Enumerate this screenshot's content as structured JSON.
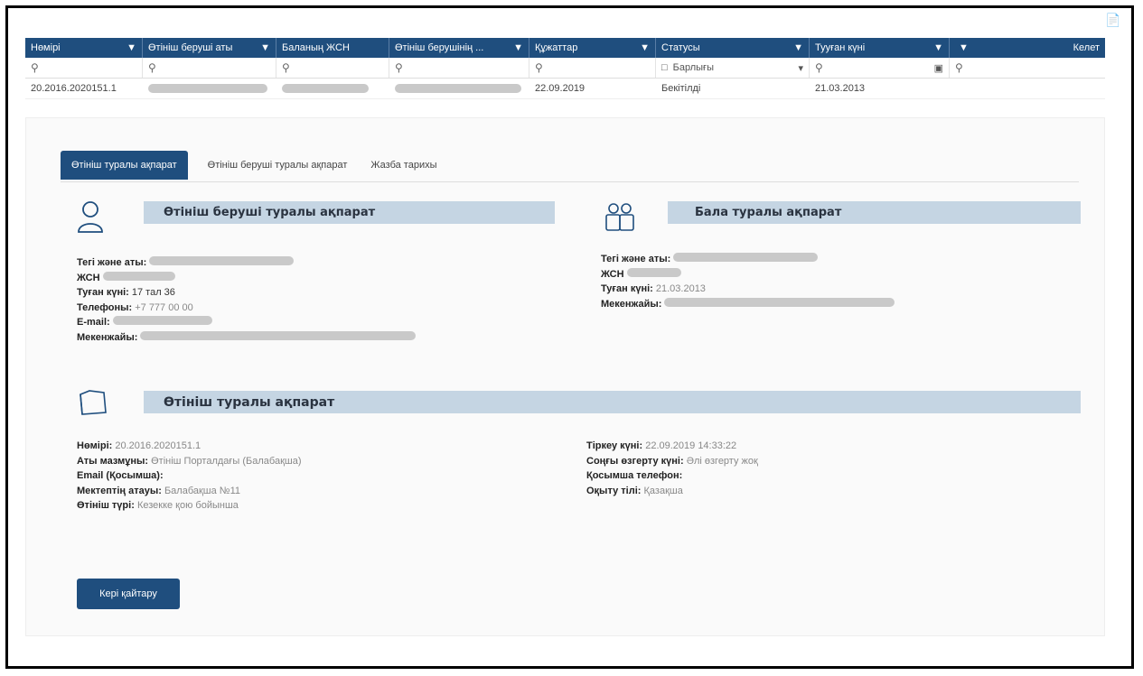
{
  "grid": {
    "headers": [
      "Нөмірі",
      "Өтініш беруші аты",
      "Баланың ЖСН",
      "Өтініш берушінің ...",
      "Құжаттар",
      "Статусы",
      "Тууған күні",
      "",
      "Келет"
    ],
    "filter_status": "Барлығы",
    "row": {
      "number": "20.2016.2020151.1",
      "date": "22.09.2019",
      "status": "Бекітілді",
      "birth_date": "21.03.2013"
    }
  },
  "tabs": [
    "Өтініш туралы ақпарат",
    "Өтініш беруші туралы ақпарат",
    "Жазба тарихы"
  ],
  "applicant": {
    "title": "Өтініш беруші туралы ақпарат",
    "rows": [
      {
        "label": "Тегі және аты:",
        "value": ""
      },
      {
        "label": "ЖСН",
        "value": ""
      },
      {
        "label": "Туған күні:",
        "value": "17 тал 36"
      },
      {
        "label": "Телефоны:",
        "value": "+7 777 00 00"
      },
      {
        "label": "E-mail:",
        "value": ""
      },
      {
        "label": "Мекенжайы:",
        "value": ""
      }
    ]
  },
  "child": {
    "title": "Бала туралы ақпарат",
    "rows": [
      {
        "label": "Тегі және аты:",
        "value": ""
      },
      {
        "label": "ЖСН",
        "value": ""
      },
      {
        "label": "Туған күні:",
        "value": "21.03.2013"
      },
      {
        "label": "Мекенжайы:",
        "value": ""
      }
    ]
  },
  "application": {
    "title": "Өтініш туралы ақпарат",
    "left": [
      {
        "label": "Нөмірі:",
        "value": "20.2016.2020151.1"
      },
      {
        "label": "Аты мазмұны:",
        "value": "Өтініш Порталдағы (Балабақша)"
      },
      {
        "label": "Email (Қосымша):",
        "value": ""
      },
      {
        "label": "Мектептің атауы:",
        "value": "Балабақша №11"
      },
      {
        "label": "Өтініш түрі:",
        "value": "Кезекке қою бойынша"
      }
    ],
    "right": [
      {
        "label": "Тіркеу күні:",
        "value": "22.09.2019 14:33:22"
      },
      {
        "label": "Соңғы өзгерту күні:",
        "value": "Әлі өзгерту жоқ"
      },
      {
        "label": "Қосымша телефон:",
        "value": ""
      },
      {
        "label": "Оқыту тілі:",
        "value": "Қазақша"
      }
    ]
  },
  "actions": {
    "submit_label": "Кері қайтару"
  },
  "colors": {
    "header": "#1f4e7e",
    "section": "#c5d5e3"
  }
}
